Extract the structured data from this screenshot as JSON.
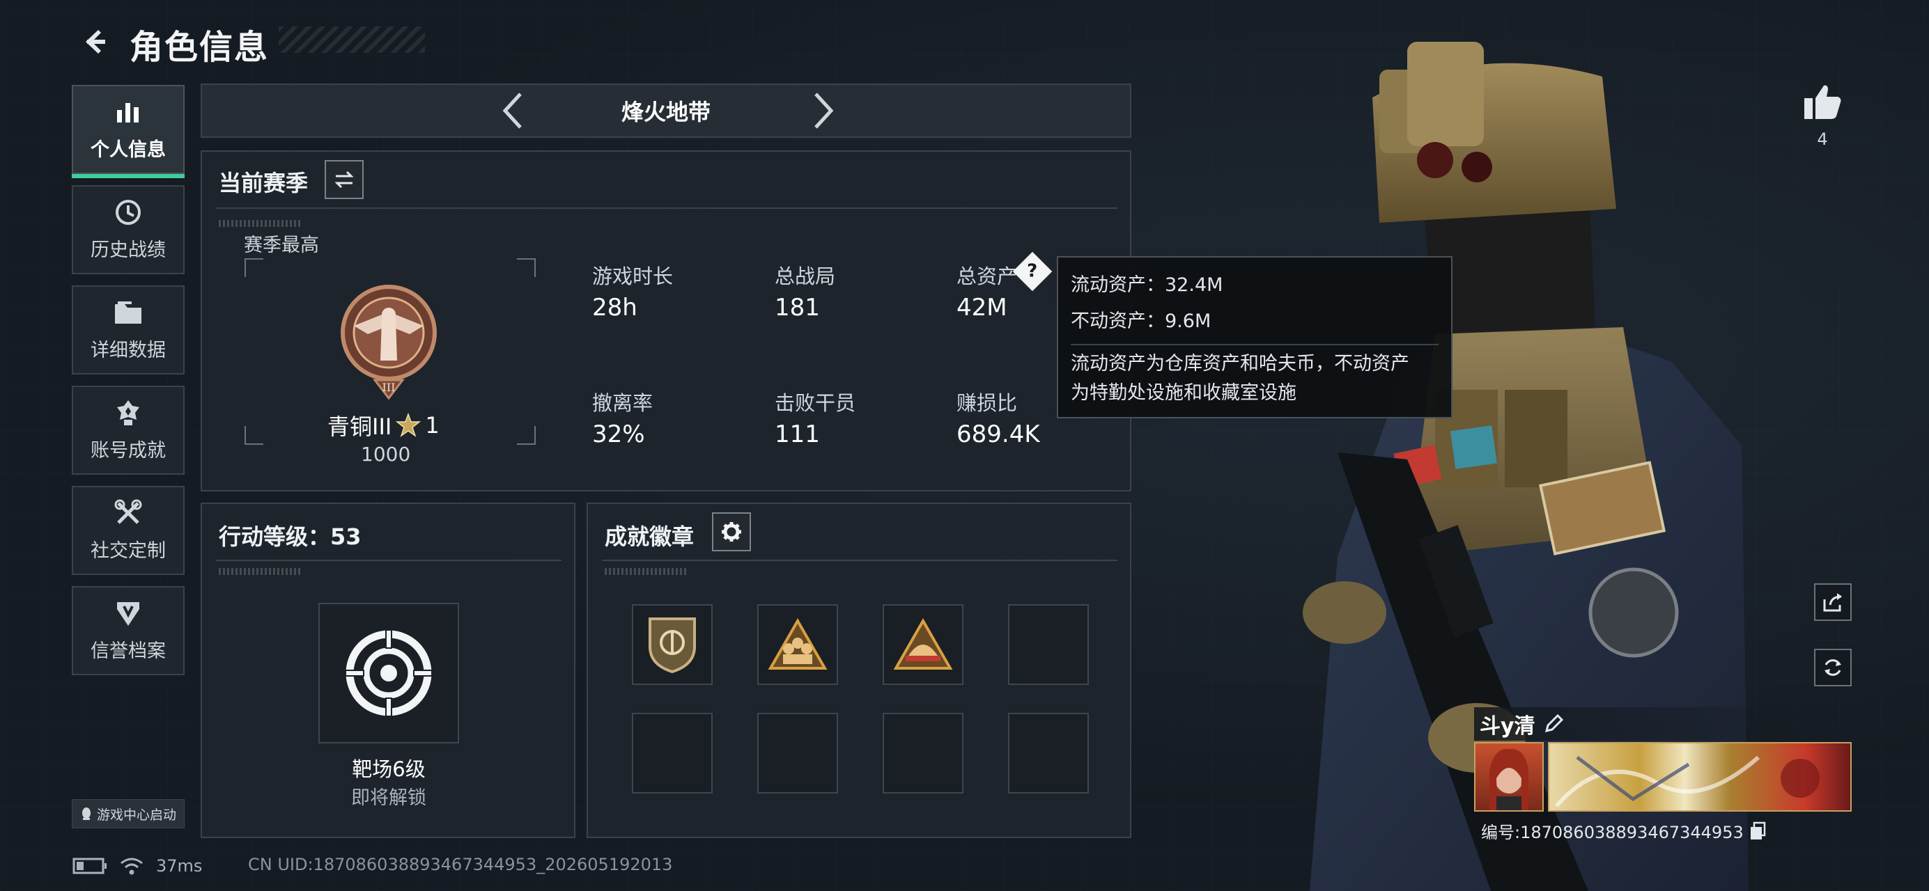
{
  "header": {
    "title": "角色信息"
  },
  "sidebar": {
    "items": [
      {
        "label": "个人信息",
        "icon": "bar-chart-icon",
        "active": true
      },
      {
        "label": "历史战绩",
        "icon": "history-clock-icon"
      },
      {
        "label": "详细数据",
        "icon": "folder-icon"
      },
      {
        "label": "账号成就",
        "icon": "achievement-medal-icon"
      },
      {
        "label": "社交定制",
        "icon": "tools-icon"
      },
      {
        "label": "信誉档案",
        "icon": "shield-badge-icon"
      }
    ],
    "game_center_label": "游戏中心启动"
  },
  "mode_selector": {
    "title": "烽火地带"
  },
  "season": {
    "title": "当前赛季",
    "best_label": "赛季最高",
    "rank_name": "青铜III",
    "rank_stars": "1",
    "rank_score": "1000",
    "stats": [
      {
        "label": "游戏时长",
        "value": "28h"
      },
      {
        "label": "总战局",
        "value": "181"
      },
      {
        "label": "总资产",
        "value": "42M"
      },
      {
        "label": "撤离率",
        "value": "32%"
      },
      {
        "label": "击败干员",
        "value": "111"
      },
      {
        "label": "赚损比",
        "value": "689.4K"
      }
    ]
  },
  "tooltip": {
    "line1": "流动资产：32.4M",
    "line2": "不动资产：9.6M",
    "desc1": "流动资产为仓库资产和哈夫币，不动资产",
    "desc2": "为特勤处设施和收藏室设施"
  },
  "action_level": {
    "title": "行动等级：53",
    "item_name": "靶场6级",
    "item_status": "即将解锁"
  },
  "achievements": {
    "title": "成就徽章"
  },
  "likes": {
    "count": "4"
  },
  "player": {
    "name": "斗y清",
    "id": "编号:18708603889346734495​3"
  },
  "status_bar": {
    "ping": "37ms",
    "uid": "CN UID:18708603889346734495​3_202605192013"
  },
  "colors": {
    "accent": "#3ccf9b",
    "panel": "#1e252c",
    "border": "#3a434c"
  }
}
